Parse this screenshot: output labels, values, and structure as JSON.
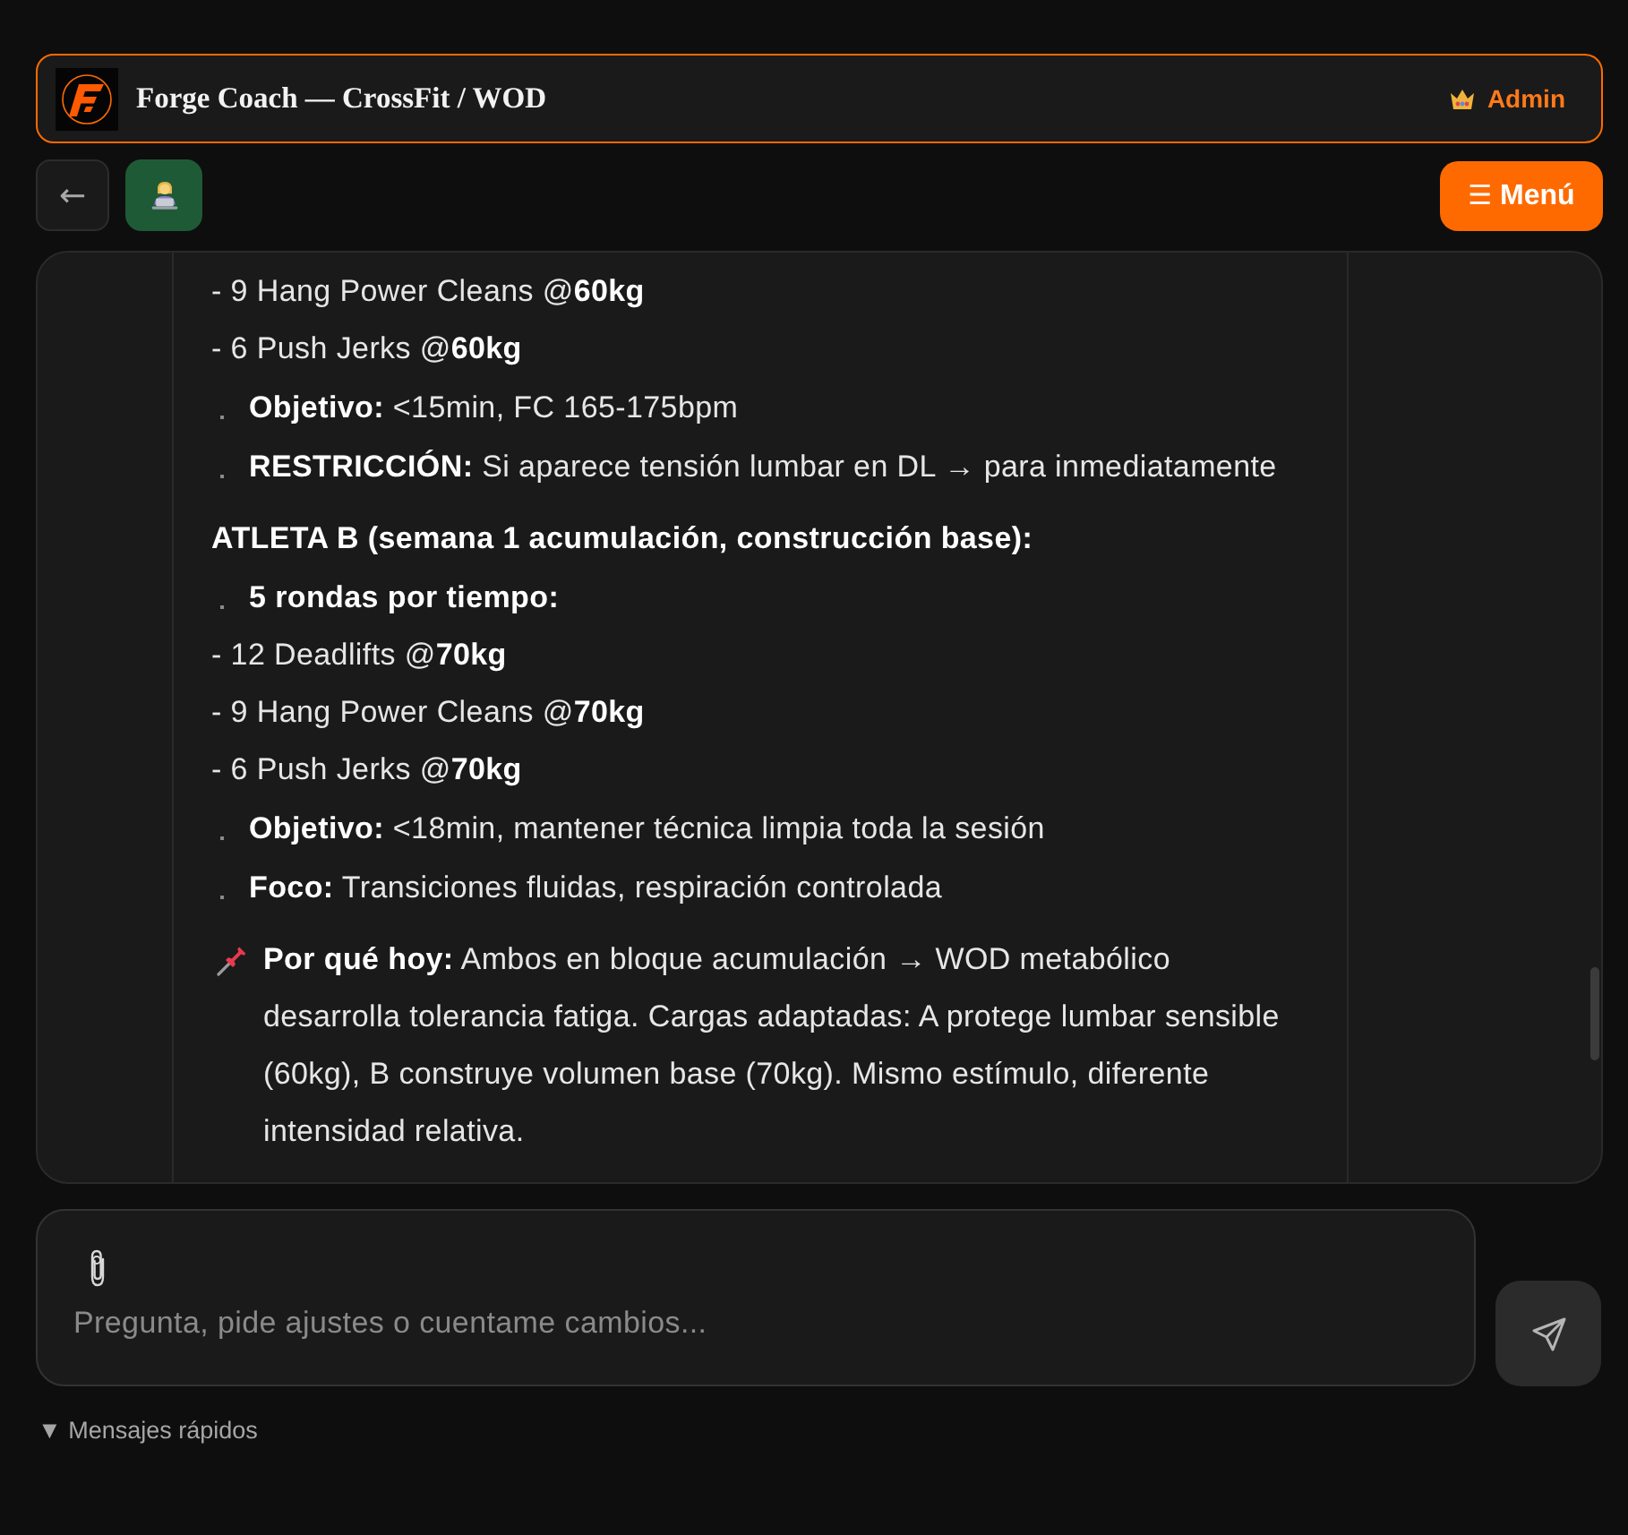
{
  "header": {
    "title": "Forge Coach — CrossFit / WOD",
    "role": "Admin"
  },
  "toolbar": {
    "back": "←",
    "menu_icon": "☰",
    "menu_label": "Menú"
  },
  "message": {
    "blocks": [
      {
        "kind": "item",
        "text": "- 9 Hang Power Cleans @**60kg**"
      },
      {
        "kind": "item",
        "text": "- 6 Push Jerks @**60kg**"
      },
      {
        "kind": "bullet",
        "text": "**Objetivo:** <15min, FC 165-175bpm"
      },
      {
        "kind": "bullet",
        "text": "**RESTRICCIÓN:** Si aparece tensión lumbar en DL → para inmediatamente"
      },
      {
        "kind": "heading",
        "text": "ATLETA B (semana 1 acumulación, construcción base):"
      },
      {
        "kind": "bullet_heading",
        "text": "5 rondas por tiempo:"
      },
      {
        "kind": "item",
        "text": "- 12 Deadlifts @**70kg**"
      },
      {
        "kind": "item",
        "text": "- 9 Hang Power Cleans @**70kg**"
      },
      {
        "kind": "item",
        "text": "- 6 Push Jerks @**70kg**"
      },
      {
        "kind": "bullet",
        "text": "**Objetivo:** <18min, mantener técnica limpia toda la sesión"
      },
      {
        "kind": "bullet",
        "text": "**Foco:** Transiciones fluidas, respiración controlada"
      },
      {
        "kind": "note",
        "text": "**Por qué hoy:** Ambos en bloque acumulación → WOD metabólico desarrolla tolerancia fatiga. Cargas adaptadas: A protege lumbar sensible (60kg), B construye volumen base (70kg). Mismo estímulo, diferente intensidad relativa."
      }
    ]
  },
  "composer": {
    "placeholder": "Pregunta, pide ajustes o cuentame cambios..."
  },
  "quick_messages": {
    "toggle": "▼",
    "label": "Mensajes rápidos"
  }
}
